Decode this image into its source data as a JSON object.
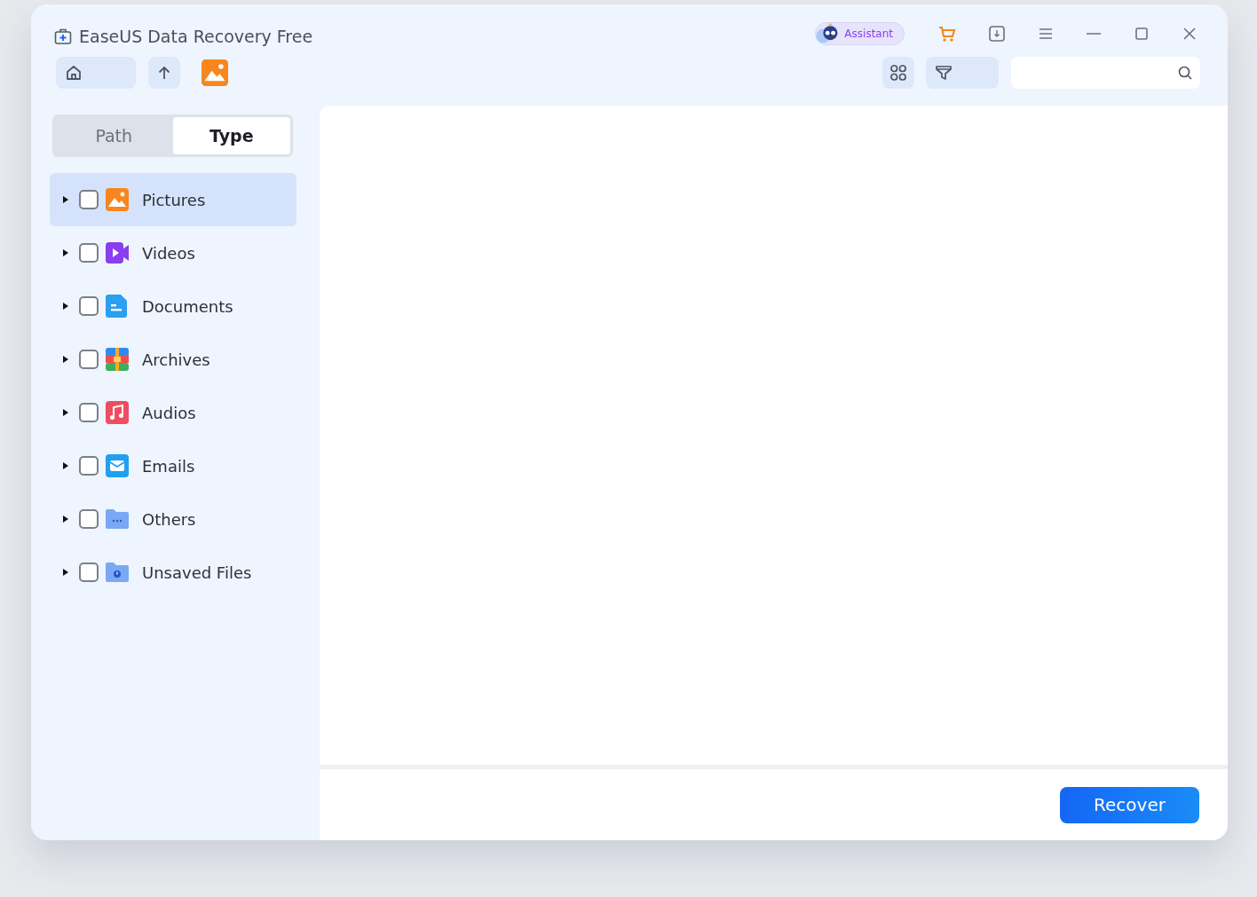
{
  "window": {
    "title": "EaseUS Data Recovery Free"
  },
  "assistant": {
    "label": "Assistant"
  },
  "tabs": [
    {
      "label": "Path",
      "selected": false
    },
    {
      "label": "Type",
      "selected": true
    }
  ],
  "categories": [
    {
      "label": "Pictures",
      "kind": "pictures",
      "selected": true,
      "checked": false,
      "expanded": false
    },
    {
      "label": "Videos",
      "kind": "videos",
      "selected": false,
      "checked": false,
      "expanded": false
    },
    {
      "label": "Documents",
      "kind": "documents",
      "selected": false,
      "checked": false,
      "expanded": false
    },
    {
      "label": "Archives",
      "kind": "archives",
      "selected": false,
      "checked": false,
      "expanded": false
    },
    {
      "label": "Audios",
      "kind": "audios",
      "selected": false,
      "checked": false,
      "expanded": false
    },
    {
      "label": "Emails",
      "kind": "emails",
      "selected": false,
      "checked": false,
      "expanded": false
    },
    {
      "label": "Others",
      "kind": "others",
      "selected": false,
      "checked": false,
      "expanded": false
    },
    {
      "label": "Unsaved Files",
      "kind": "unsaved",
      "selected": false,
      "checked": false,
      "expanded": false
    }
  ],
  "footer": {
    "button": "Recover"
  }
}
